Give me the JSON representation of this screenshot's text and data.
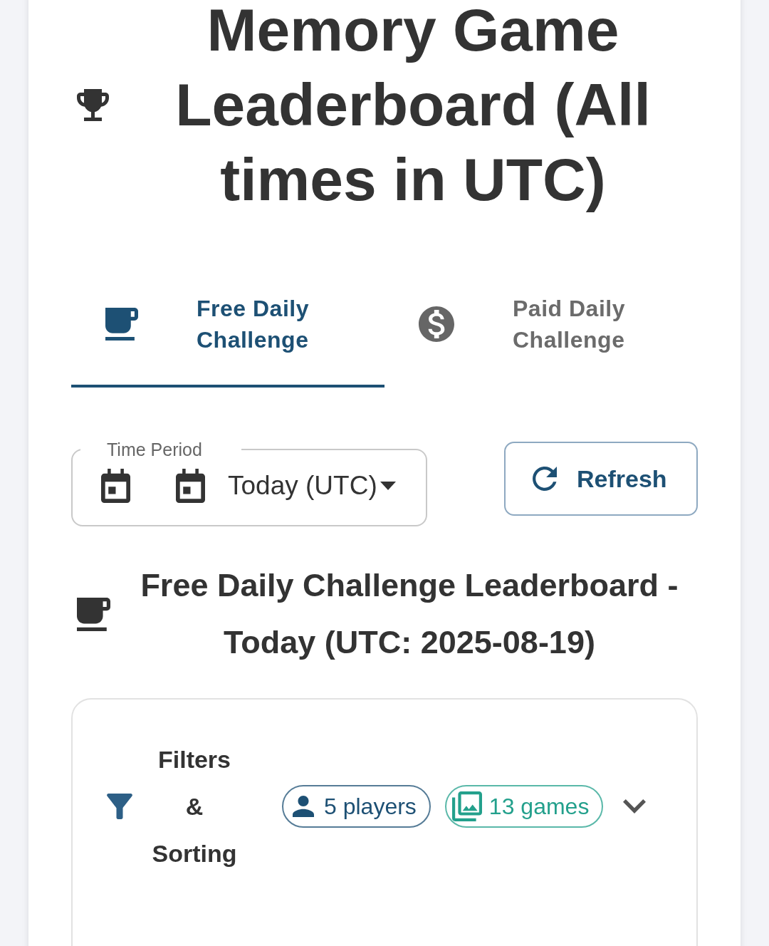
{
  "header": {
    "title": "Memory Game Leaderboard (All times in UTC)"
  },
  "tabs": [
    {
      "label": "Free Daily Challenge",
      "kind": "free",
      "selected": true
    },
    {
      "label": "Paid Daily Challenge",
      "kind": "paid",
      "selected": false
    }
  ],
  "time_period": {
    "label": "Time Period",
    "value": "Today (UTC)"
  },
  "refresh_button": {
    "label": "Refresh"
  },
  "leaderboard_heading": {
    "title": "Free Daily Challenge Leaderboard - Today (UTC: 2025-08-19)"
  },
  "filters": {
    "title": "Filters & Sorting",
    "expanded": false,
    "chips": [
      {
        "label": "5 players",
        "kind": "players",
        "color": "#1d5074"
      },
      {
        "label": "13 games",
        "kind": "games",
        "color": "#23a08c"
      }
    ]
  }
}
